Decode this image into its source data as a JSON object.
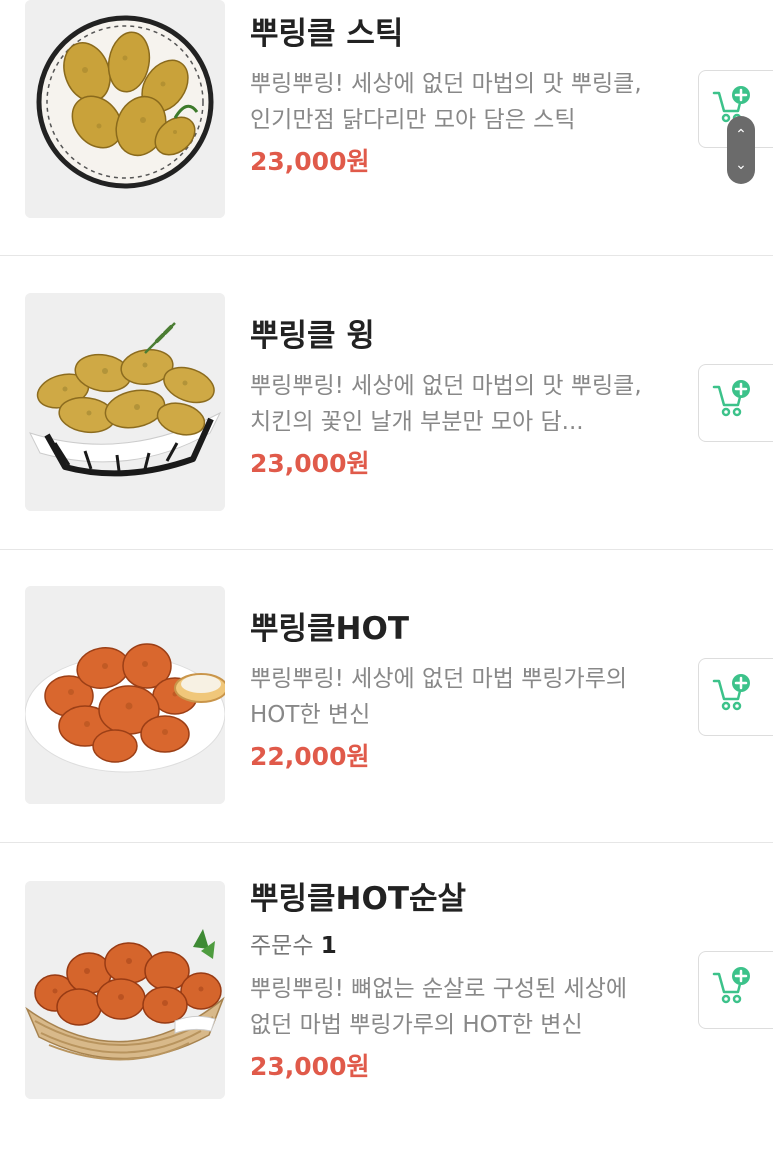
{
  "menu": {
    "items": [
      {
        "name": "뿌링클 스틱",
        "description": "뿌링뿌링! 세상에 없던 마법의 맛 뿌링클, 인기만점 닭다리만 모아 담은 스틱",
        "price": "23,000원",
        "image_icon": "fried-chicken-drumsticks-basket-icon"
      },
      {
        "name": "뿌링클 윙",
        "description": "뿌링뿌링! 세상에 없던 마법의 맛 뿌링클, 치킨의 꽃인 날개 부분만 모아 담...",
        "price": "23,000원",
        "image_icon": "fried-chicken-wings-basket-icon"
      },
      {
        "name": "뿌링클HOT",
        "description": "뿌링뿌링! 세상에 없던 마법 뿌링가루의 HOT한 변신",
        "price": "22,000원",
        "image_icon": "spicy-fried-chicken-plate-icon"
      },
      {
        "name": "뿌링클HOT순살",
        "orders_label": "주문수",
        "orders_count": "1",
        "description": "뿌링뿌링! 뼈없는 순살로 구성된 세상에 없던 마법 뿌링가루의 HOT한 변신",
        "price": "23,000원",
        "image_icon": "boneless-spicy-chicken-basket-icon"
      }
    ]
  },
  "cart_icon": "add-to-cart-icon",
  "scroll_controls": {
    "up_glyph": "⌃",
    "down_glyph": "⌄"
  },
  "colors": {
    "price": "#e05a4a",
    "cart_accent": "#3cc28a",
    "title": "#222222",
    "description": "#888888"
  }
}
